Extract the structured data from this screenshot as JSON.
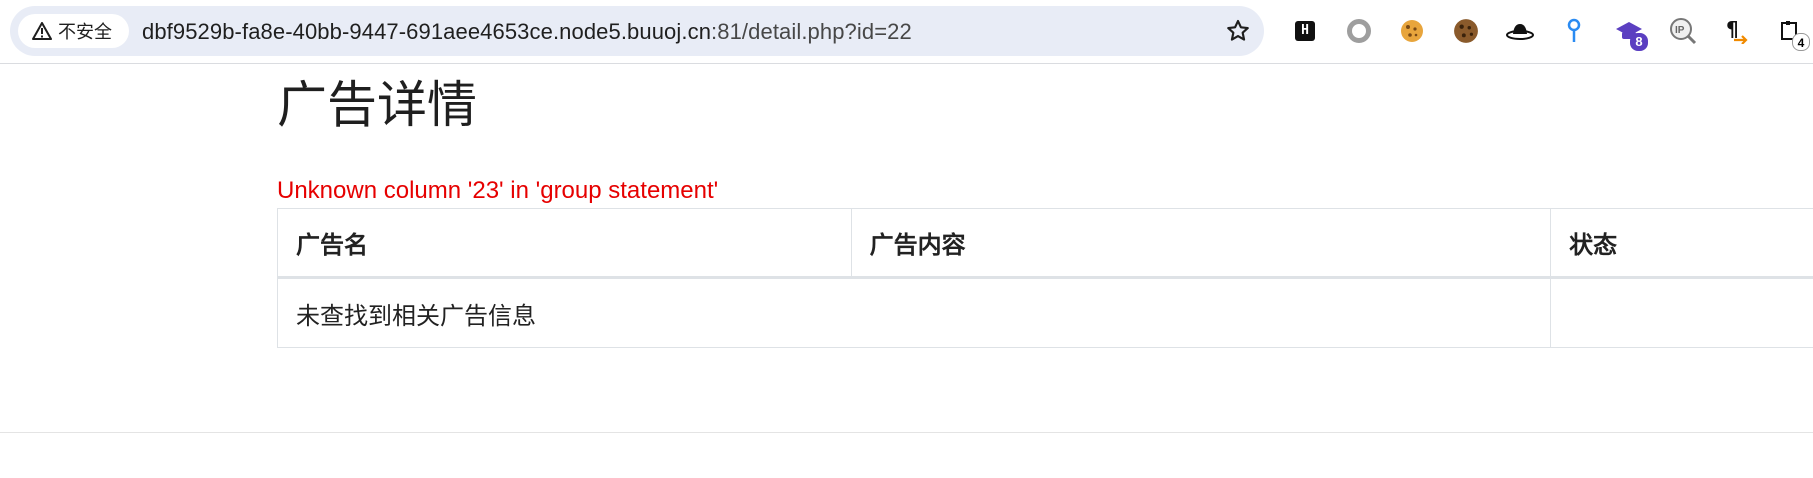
{
  "browser": {
    "security_label": "不安全",
    "url_host": "dbf9529b-fa8e-40bb-9447-691aee4653ce.node5.buuoj.cn",
    "url_rest": ":81/detail.php?id=22",
    "extensions": [
      {
        "name": "hackbar-extension-icon"
      },
      {
        "name": "circle-extension-icon"
      },
      {
        "name": "cookie-extension-icon"
      },
      {
        "name": "cookie-editor-extension-icon"
      },
      {
        "name": "hat-extension-icon"
      },
      {
        "name": "key-extension-icon"
      },
      {
        "name": "graduation-extension-icon",
        "badge": "8"
      },
      {
        "name": "ip-extension-icon"
      },
      {
        "name": "paragraph-extension-icon"
      },
      {
        "name": "puzzle-extension-icon",
        "badge": "4"
      }
    ]
  },
  "page": {
    "title": "广告详情",
    "error": "Unknown column '23' in 'group statement'",
    "table": {
      "headers": [
        "广告名",
        "广告内容",
        "状态"
      ],
      "empty_message": "未查找到相关广告信息"
    }
  }
}
